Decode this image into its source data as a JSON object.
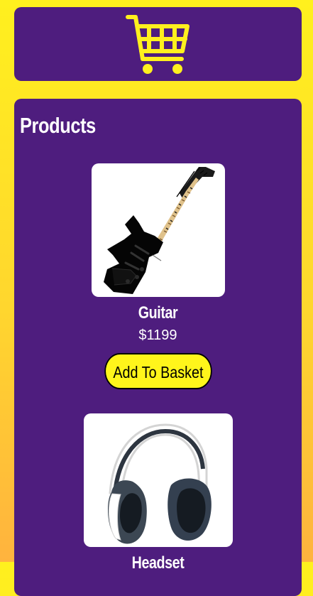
{
  "header": {
    "cart_icon": "shopping-cart-icon",
    "accent_color": "#fff01e"
  },
  "products": {
    "title": "Products",
    "items": [
      {
        "name": "Guitar",
        "price": "$1199",
        "button_label": "Add To Basket",
        "image": "electric-guitar-image"
      },
      {
        "name": "Headset",
        "price": "",
        "button_label": "",
        "image": "headset-image"
      }
    ]
  },
  "colors": {
    "panel": "#4e1d7e",
    "button": "#fff51b"
  }
}
